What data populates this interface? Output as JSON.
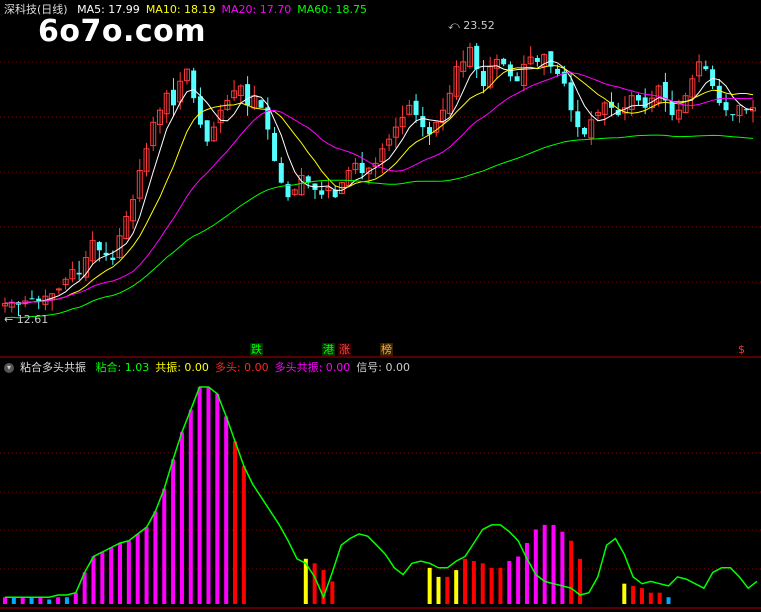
{
  "window": {
    "title": "深科技(日线)",
    "watermark": "6o7o.com"
  },
  "ma_legend": [
    {
      "label": "MA5: 17.99",
      "color": "#ffffff"
    },
    {
      "label": "MA10: 18.19",
      "color": "#ffff00"
    },
    {
      "label": "MA20: 17.70",
      "color": "#ff00ff"
    },
    {
      "label": "MA60: 18.75",
      "color": "#00ff00"
    }
  ],
  "indicator_legend": {
    "name": "粘合多头共振",
    "items": [
      {
        "label": "粘合: 1.03",
        "color": "#00ff00"
      },
      {
        "label": "共振: 0.00",
        "color": "#ffff00"
      },
      {
        "label": "多头: 0.00",
        "color": "#ff2222"
      },
      {
        "label": "多头共振: 0.00",
        "color": "#ff00ff"
      },
      {
        "label": "信号: 0.00",
        "color": "#cccccc"
      }
    ]
  },
  "annotations": {
    "high": "23.52",
    "low": "12.61",
    "tags": [
      {
        "text": "跌",
        "color": "#00ff00",
        "bg": "#003300"
      },
      {
        "text": "港",
        "color": "#00ff00",
        "bg": "#003300"
      },
      {
        "text": "涨",
        "color": "#ff4444",
        "bg": "#330000"
      },
      {
        "text": "榜",
        "color": "#ffaa44",
        "bg": "#332200"
      },
      {
        "text": "$",
        "color": "#ff3333",
        "bg": "#000000"
      }
    ]
  },
  "colors": {
    "up": "#ff3b3b",
    "down": "#54ffff",
    "grid": "#8b0000",
    "ma5": "#ffffff",
    "ma10": "#ffff00",
    "ma20": "#ff00ff",
    "ma60": "#00ff00",
    "osc_line": "#00ff00",
    "bar_magenta": "#ff00ff",
    "bar_red": "#ff0000",
    "bar_yellow": "#ffff00",
    "bar_blue": "#00aaff"
  },
  "chart_data": [
    {
      "type": "candlestick",
      "title": "深科技(日线)",
      "ylim": [
        11.5,
        24.5
      ],
      "closes": [
        12.6,
        12.65,
        12.55,
        12.7,
        12.8,
        12.7,
        12.9,
        13.0,
        13.2,
        13.6,
        14.0,
        13.8,
        14.5,
        15.2,
        14.8,
        14.6,
        14.4,
        15.4,
        16.2,
        16.9,
        18.1,
        19.0,
        20.1,
        20.6,
        21.3,
        20.8,
        21.8,
        22.3,
        21.1,
        20.0,
        19.3,
        19.9,
        20.6,
        21.0,
        21.4,
        21.6,
        20.8,
        21.2,
        20.7,
        19.8,
        18.5,
        17.6,
        17.0,
        17.3,
        17.9,
        17.6,
        17.3,
        17.1,
        17.4,
        17.0,
        17.6,
        18.1,
        18.4,
        18.0,
        18.2,
        18.4,
        19.0,
        19.4,
        19.9,
        20.3,
        20.8,
        20.4,
        19.9,
        19.6,
        20.1,
        20.6,
        21.3,
        22.4,
        22.6,
        23.2,
        22.3,
        21.6,
        22.4,
        22.7,
        22.5,
        22.0,
        21.8,
        22.5,
        22.8,
        22.6,
        22.9,
        22.4,
        22.1,
        21.7,
        20.6,
        19.9,
        19.6,
        20.2,
        20.5,
        20.9,
        20.7,
        20.4,
        20.7,
        21.2,
        21.0,
        20.7,
        21.1,
        21.6,
        21.0,
        20.4,
        20.6,
        21.2,
        21.9,
        22.6,
        22.3,
        21.6,
        20.9,
        20.6,
        20.4,
        20.8,
        20.6,
        20.7
      ]
    },
    {
      "type": "line",
      "title": "粘合多头共振",
      "series_names": [
        "粘合"
      ],
      "values": [
        0.3,
        0.3,
        0.3,
        0.3,
        0.3,
        0.3,
        0.4,
        0.4,
        0.5,
        1.4,
        2.1,
        2.3,
        2.5,
        2.7,
        2.8,
        3.1,
        3.4,
        4.1,
        5.1,
        6.4,
        7.6,
        8.6,
        9.6,
        9.6,
        9.3,
        8.3,
        7.2,
        6.1,
        5.3,
        4.7,
        4.1,
        3.5,
        2.8,
        2.0,
        1.8,
        1.2,
        0.3,
        1.4,
        2.6,
        2.9,
        3.1,
        3.0,
        2.6,
        2.2,
        1.6,
        1.3,
        1.8,
        1.9,
        1.8,
        1.6,
        1.6,
        1.9,
        2.1,
        2.7,
        3.3,
        3.5,
        3.5,
        3.2,
        2.8,
        2.0,
        1.3,
        1.0,
        0.9,
        0.8,
        0.7,
        0.4,
        0.5,
        1.2,
        2.6,
        2.9,
        2.2,
        1.2,
        0.9,
        1.0,
        0.9,
        0.8,
        1.2,
        1.1,
        0.9,
        0.7,
        1.4,
        1.6,
        1.6,
        1.2,
        0.7,
        1.0
      ],
      "histogram": [
        {
          "v": 0.3,
          "c": "m"
        },
        {
          "v": 0.3,
          "c": "b"
        },
        {
          "v": 0.3,
          "c": "m"
        },
        {
          "v": 0.3,
          "c": "b"
        },
        {
          "v": 0.3,
          "c": "m"
        },
        {
          "v": 0.2,
          "c": "b"
        },
        {
          "v": 0.3,
          "c": "m"
        },
        {
          "v": 0.3,
          "c": "b"
        },
        {
          "v": 0.5,
          "c": "m"
        },
        {
          "v": 1.4,
          "c": "m"
        },
        {
          "v": 2.1,
          "c": "m"
        },
        {
          "v": 2.3,
          "c": "m"
        },
        {
          "v": 2.5,
          "c": "m"
        },
        {
          "v": 2.7,
          "c": "m"
        },
        {
          "v": 2.8,
          "c": "m"
        },
        {
          "v": 3.1,
          "c": "m"
        },
        {
          "v": 3.4,
          "c": "m"
        },
        {
          "v": 4.1,
          "c": "m"
        },
        {
          "v": 5.1,
          "c": "m"
        },
        {
          "v": 6.4,
          "c": "m"
        },
        {
          "v": 7.6,
          "c": "m"
        },
        {
          "v": 8.6,
          "c": "m"
        },
        {
          "v": 9.6,
          "c": "m"
        },
        {
          "v": 9.6,
          "c": "m"
        },
        {
          "v": 9.3,
          "c": "m"
        },
        {
          "v": 8.3,
          "c": "m"
        },
        {
          "v": 7.2,
          "c": "r"
        },
        {
          "v": 6.1,
          "c": "r"
        },
        null,
        null,
        null,
        null,
        null,
        null,
        {
          "v": 2.0,
          "c": "y"
        },
        {
          "v": 1.8,
          "c": "r"
        },
        {
          "v": 1.5,
          "c": "r"
        },
        {
          "v": 1.0,
          "c": "r"
        },
        null,
        null,
        null,
        null,
        null,
        null,
        null,
        null,
        null,
        null,
        {
          "v": 1.6,
          "c": "y"
        },
        {
          "v": 1.2,
          "c": "y"
        },
        {
          "v": 1.2,
          "c": "r"
        },
        {
          "v": 1.5,
          "c": "y"
        },
        {
          "v": 2.0,
          "c": "r"
        },
        {
          "v": 1.9,
          "c": "r"
        },
        {
          "v": 1.8,
          "c": "r"
        },
        {
          "v": 1.6,
          "c": "r"
        },
        {
          "v": 1.6,
          "c": "r"
        },
        {
          "v": 1.9,
          "c": "m"
        },
        {
          "v": 2.1,
          "c": "m"
        },
        {
          "v": 2.7,
          "c": "m"
        },
        {
          "v": 3.3,
          "c": "m"
        },
        {
          "v": 3.5,
          "c": "m"
        },
        {
          "v": 3.5,
          "c": "m"
        },
        {
          "v": 3.2,
          "c": "m"
        },
        {
          "v": 2.8,
          "c": "r"
        },
        {
          "v": 2.0,
          "c": "r"
        },
        null,
        null,
        null,
        null,
        {
          "v": 0.9,
          "c": "y"
        },
        {
          "v": 0.8,
          "c": "r"
        },
        {
          "v": 0.7,
          "c": "r"
        },
        {
          "v": 0.5,
          "c": "r"
        },
        {
          "v": 0.5,
          "c": "r"
        },
        {
          "v": 0.3,
          "c": "b"
        },
        null,
        null,
        null,
        null,
        null,
        null,
        null,
        null,
        null,
        null,
        null,
        null,
        null,
        null,
        null,
        {
          "v": 0.3,
          "c": "b"
        },
        {
          "v": 0.3,
          "c": "y"
        },
        {
          "v": 0.4,
          "c": "b"
        },
        {
          "v": 0.6,
          "c": "r"
        },
        {
          "v": 1.2,
          "c": "m"
        },
        {
          "v": 1.4,
          "c": "r"
        },
        {
          "v": 1.5,
          "c": "r"
        },
        {
          "v": 1.6,
          "c": "r"
        },
        {
          "v": 1.2,
          "c": "r"
        },
        {
          "v": 0.7,
          "c": "r"
        },
        null
      ]
    }
  ]
}
